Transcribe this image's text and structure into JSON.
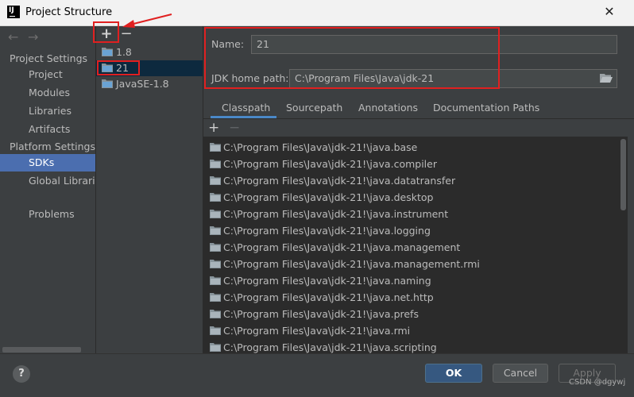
{
  "window": {
    "title": "Project Structure",
    "logo_text": "IJ",
    "close_glyph": "✕"
  },
  "nav": {
    "back_glyph": "←",
    "forward_glyph": "→",
    "project_settings_header": "Project Settings",
    "project_items": [
      "Project",
      "Modules",
      "Libraries",
      "Artifacts"
    ],
    "platform_settings_header": "Platform Settings",
    "platform_items": [
      "SDKs",
      "Global Libraries"
    ],
    "problems": "Problems"
  },
  "sdk_toolbar": {
    "add_glyph": "+",
    "remove_glyph": "−"
  },
  "sdks": [
    {
      "name": "1.8"
    },
    {
      "name": "21"
    },
    {
      "name": "JavaSE-1.8"
    }
  ],
  "detail": {
    "name_label": "Name:",
    "name_value": "21",
    "jdk_label": "JDK home path:",
    "jdk_value": "C:\\Program Files\\Java\\jdk-21"
  },
  "tabs": [
    "Classpath",
    "Sourcepath",
    "Annotations",
    "Documentation Paths"
  ],
  "classpath_toolbar": {
    "add_glyph": "+",
    "remove_glyph": "−"
  },
  "classpath": [
    "C:\\Program Files\\Java\\jdk-21!\\java.base",
    "C:\\Program Files\\Java\\jdk-21!\\java.compiler",
    "C:\\Program Files\\Java\\jdk-21!\\java.datatransfer",
    "C:\\Program Files\\Java\\jdk-21!\\java.desktop",
    "C:\\Program Files\\Java\\jdk-21!\\java.instrument",
    "C:\\Program Files\\Java\\jdk-21!\\java.logging",
    "C:\\Program Files\\Java\\jdk-21!\\java.management",
    "C:\\Program Files\\Java\\jdk-21!\\java.management.rmi",
    "C:\\Program Files\\Java\\jdk-21!\\java.naming",
    "C:\\Program Files\\Java\\jdk-21!\\java.net.http",
    "C:\\Program Files\\Java\\jdk-21!\\java.prefs",
    "C:\\Program Files\\Java\\jdk-21!\\java.rmi",
    "C:\\Program Files\\Java\\jdk-21!\\java.scripting"
  ],
  "buttons": {
    "help": "?",
    "ok": "OK",
    "cancel": "Cancel",
    "apply": "Apply"
  },
  "watermark": "CSDN @dgywj",
  "colors": {
    "selection": "#4b6eaf",
    "accent_tab": "#4a88c7",
    "annotation": "#e02020"
  },
  "icons": [
    "folder-icon",
    "help-icon",
    "folder-open-icon"
  ]
}
